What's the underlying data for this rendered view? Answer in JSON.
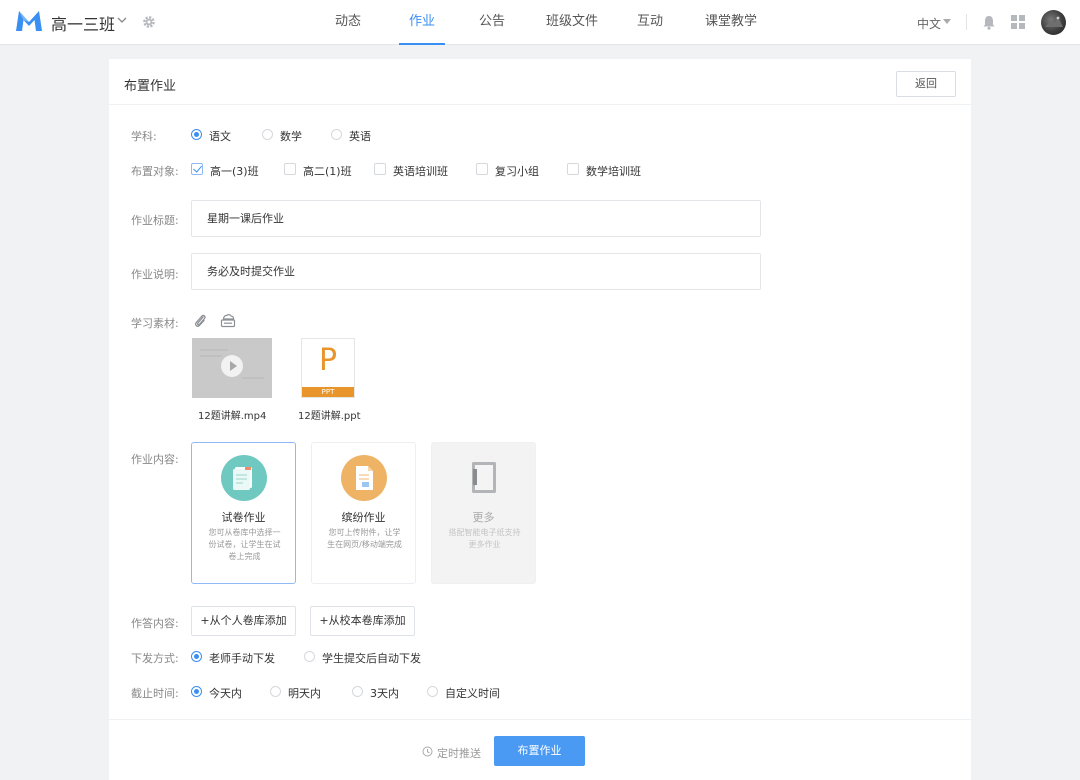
{
  "header": {
    "class_name": "高一三班",
    "nav": [
      {
        "label": "动态"
      },
      {
        "label": "作业"
      },
      {
        "label": "公告"
      },
      {
        "label": "班级文件"
      },
      {
        "label": "互动"
      },
      {
        "label": "课堂教学"
      }
    ],
    "active_nav": "作业",
    "language": "中文"
  },
  "page": {
    "title": "布置作业",
    "back_label": "返回"
  },
  "form": {
    "subject": {
      "label": "学科:",
      "options": [
        "语文",
        "数学",
        "英语"
      ],
      "selected": "语文"
    },
    "targets": {
      "label": "布置对象:",
      "options": [
        "高一(3)班",
        "高二(1)班",
        "英语培训班",
        "复习小组",
        "数学培训班"
      ],
      "checked": [
        "高一(3)班"
      ]
    },
    "title_field": {
      "label": "作业标题:",
      "value": "星期一课后作业"
    },
    "desc_field": {
      "label": "作业说明:",
      "value": "务必及时提交作业"
    },
    "materials": {
      "label": "学习素材:",
      "icons": [
        "paperclip-icon",
        "cloud-drive-icon"
      ],
      "files": [
        {
          "name": "12题讲解.mp4",
          "type": "video"
        },
        {
          "name": "12题讲解.ppt",
          "type": "ppt",
          "glyph": "P",
          "band": "PPT"
        }
      ]
    },
    "content": {
      "label": "作业内容:",
      "types": [
        {
          "title": "试卷作业",
          "desc": "您可从卷库中选择一份试卷，让学生在试卷上完成",
          "color": "#6fc9c1",
          "selected": true
        },
        {
          "title": "缤纷作业",
          "desc": "您可上传附件，让学生在网页/移动端完成",
          "color": "#efb366",
          "selected": false
        },
        {
          "title": "更多",
          "desc": "搭配智能电子纸支持更多作业",
          "color": "#f3f3f4",
          "disabled": true
        }
      ]
    },
    "answer": {
      "label": "作答内容:",
      "buttons": [
        "+从个人卷库添加",
        "+从校本卷库添加"
      ]
    },
    "delivery": {
      "label": "下发方式:",
      "options": [
        "老师手动下发",
        "学生提交后自动下发"
      ],
      "selected": "老师手动下发"
    },
    "deadline": {
      "label": "截止时间:",
      "options": [
        "今天内",
        "明天内",
        "3天内",
        "自定义时间"
      ],
      "selected": "今天内"
    }
  },
  "footer": {
    "timer_label": "定时推送",
    "submit_label": "布置作业"
  },
  "colors": {
    "accent": "#3a8ff3",
    "primary_button": "#4a9af4",
    "ppt_orange": "#e8962c"
  }
}
